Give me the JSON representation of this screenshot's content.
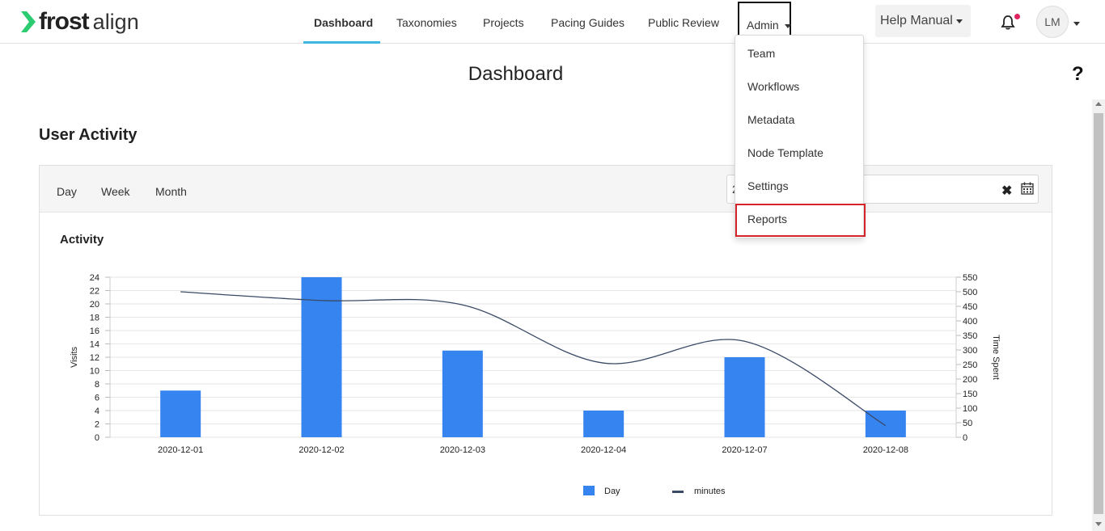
{
  "brand": {
    "name": "frost",
    "product": "align",
    "accent": "#2ecc71"
  },
  "nav": {
    "items": [
      {
        "label": "Dashboard",
        "active": true
      },
      {
        "label": "Taxonomies"
      },
      {
        "label": "Projects"
      },
      {
        "label": "Pacing Guides"
      },
      {
        "label": "Public Review"
      },
      {
        "label": "Admin"
      }
    ],
    "active_underline_color": "#3fb6e0"
  },
  "header": {
    "help_label": "Help Manual",
    "avatar_initials": "LM",
    "notification_dot_color": "#e0245e"
  },
  "admin_menu": {
    "items": [
      "Team",
      "Workflows",
      "Metadata",
      "Node Template",
      "Settings",
      "Reports"
    ],
    "highlighted": "Reports",
    "highlight_color": "#d3242b"
  },
  "page": {
    "title": "Dashboard",
    "help_glyph": "?"
  },
  "user_activity": {
    "title": "User Activity",
    "periods": [
      "Day",
      "Week",
      "Month"
    ],
    "date_value": "2",
    "clear_glyph": "✖",
    "chart_title": "Activity"
  },
  "chart_data": {
    "type": "bar",
    "categories": [
      "2020-12-01",
      "2020-12-02",
      "2020-12-03",
      "2020-12-04",
      "2020-12-07",
      "2020-12-08"
    ],
    "series": [
      {
        "name": "Day",
        "type": "bar",
        "axis": "left",
        "color": "#3584f0",
        "values": [
          7,
          24,
          13,
          4,
          12,
          4
        ]
      },
      {
        "name": "minutes",
        "type": "line",
        "axis": "right",
        "color": "#3b4a66",
        "values": [
          500,
          470,
          455,
          255,
          330,
          40
        ]
      }
    ],
    "ylabel": "Visits",
    "ylim": [
      0,
      24
    ],
    "yticks": [
      0,
      2,
      4,
      6,
      8,
      10,
      12,
      14,
      16,
      18,
      20,
      22,
      24
    ],
    "y2label": "Time Spent",
    "y2lim": [
      0,
      550
    ],
    "y2ticks": [
      0,
      50,
      100,
      150,
      200,
      250,
      300,
      350,
      400,
      450,
      500,
      550
    ],
    "grid": true,
    "legend": "bottom-center"
  }
}
